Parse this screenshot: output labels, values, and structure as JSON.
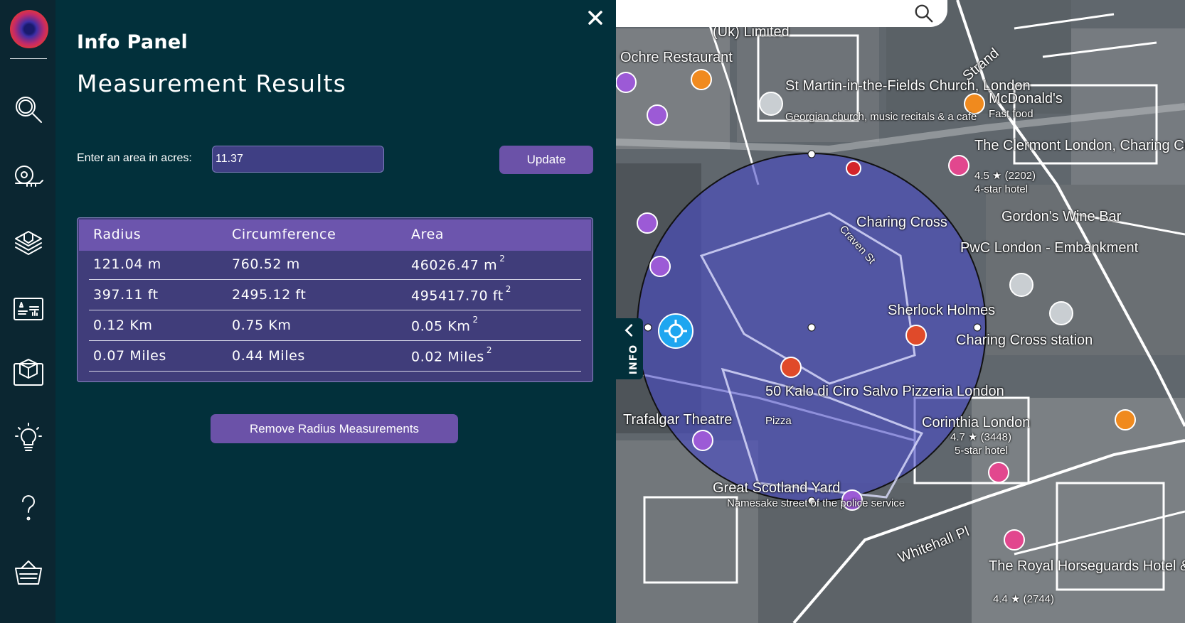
{
  "panel": {
    "title": "Info Panel",
    "subtitle": "Measurement Results",
    "area_label": "Enter an area in acres:",
    "area_value": "11.37",
    "update_label": "Update",
    "remove_label": "Remove Radius Measurements",
    "close_label": "×"
  },
  "results": {
    "headers": [
      "Radius",
      "Circumference",
      "Area"
    ],
    "rows": [
      {
        "radius": "121.04 m",
        "circumference": "760.52 m",
        "area": "46026.47 m",
        "area_unit_power": "2"
      },
      {
        "radius": "397.11 ft",
        "circumference": "2495.12 ft",
        "area": "495417.70 ft",
        "area_unit_power": "2"
      },
      {
        "radius": "0.12 Km",
        "circumference": "0.75 Km",
        "area": "0.05 Km",
        "area_unit_power": "2"
      },
      {
        "radius": "0.07 Miles",
        "circumference": "0.44 Miles",
        "area": "0.02 Miles",
        "area_unit_power": "2"
      }
    ]
  },
  "sidebar": {
    "icons": [
      "search-icon",
      "measure-tape-icon",
      "layers-icon",
      "dashboard-icon",
      "3d-model-icon",
      "lightbulb-icon",
      "help-icon",
      "basket-icon"
    ]
  },
  "map": {
    "info_tab_label": "INFO",
    "labels": [
      "(Uk) Limited",
      "Ochre Restaurant",
      "St Martin-in-the-Fields Church, London",
      "Georgian church, music recitals & a cafe",
      "McDonald's",
      "Fast food",
      "The Clermont London, Charing Cross",
      "4.5 ★ (2202)",
      "4-star hotel",
      "Charing Cross",
      "Gordon's Wine Bar",
      "PwC London - Embankment",
      "Sherlock Holmes",
      "Charing Cross station",
      "50 Kalo di Ciro Salvo Pizzeria London",
      "Pizza",
      "Corinthia London",
      "4.7 ★ (3448)",
      "5-star hotel",
      "Trafalgar Theatre",
      "Great Scotland Yard",
      "Namesake street of the police service",
      "Whitehall Pl",
      "The Royal Horseguards Hotel & One Whitehall...",
      "4.4 ★ (2744)",
      "Strand",
      "Craven St"
    ],
    "circle_color": "#4a4cc5"
  }
}
